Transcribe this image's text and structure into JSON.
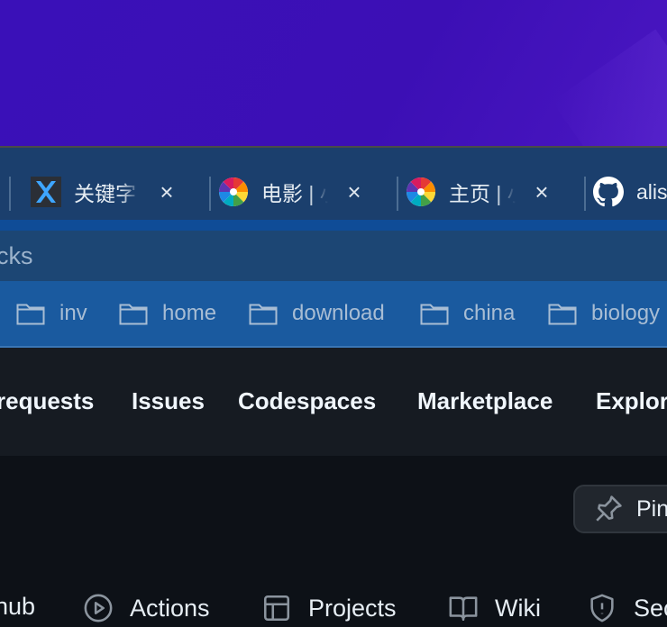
{
  "tabs": [
    {
      "title": "关键字",
      "icon": "x-app-icon",
      "close": "×"
    },
    {
      "title": "电影 | 小",
      "icon": "color-wheel-icon",
      "close": "×"
    },
    {
      "title": "主页 | 小",
      "icon": "color-wheel-icon",
      "close": "×"
    },
    {
      "title": "alis",
      "icon": "github-icon",
      "close": ""
    }
  ],
  "address": {
    "text": "cks"
  },
  "bookmarks": [
    {
      "label": "inv"
    },
    {
      "label": "home"
    },
    {
      "label": "download"
    },
    {
      "label": "china"
    },
    {
      "label": "biology"
    }
  ],
  "github_nav": [
    {
      "label": "requests"
    },
    {
      "label": "Issues"
    },
    {
      "label": "Codespaces"
    },
    {
      "label": "Marketplace"
    },
    {
      "label": "Explor"
    }
  ],
  "pin_button": {
    "label": "Pin"
  },
  "repo_nav": [
    {
      "label": "hub"
    },
    {
      "label": "Actions",
      "icon": "play-icon"
    },
    {
      "label": "Projects",
      "icon": "table-icon"
    },
    {
      "label": "Wiki",
      "icon": "book-icon"
    },
    {
      "label": "Sec",
      "icon": "shield-icon"
    }
  ]
}
